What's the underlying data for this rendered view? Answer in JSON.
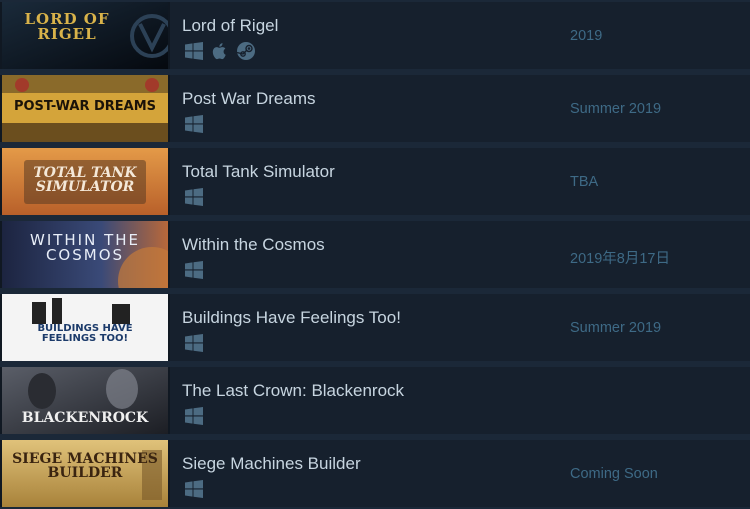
{
  "games": [
    {
      "title": "Lord of Rigel",
      "release": "2019",
      "platforms": [
        "windows-icon",
        "apple-icon",
        "steam-icon"
      ],
      "capsule_text": "LORD OF RIGEL",
      "capsule_colors": {
        "bg": "#0b1420",
        "text": "#d9b34a"
      }
    },
    {
      "title": "Post War Dreams",
      "release": "Summer 2019",
      "platforms": [
        "windows-icon"
      ],
      "capsule_text": "POST-WAR DREAMS",
      "capsule_colors": {
        "bg": "#d4a43a",
        "text": "#1a1208"
      }
    },
    {
      "title": "Total Tank Simulator",
      "release": "TBA",
      "platforms": [
        "windows-icon"
      ],
      "capsule_text": "TOTAL TANK SIMULATOR",
      "capsule_colors": {
        "bg": "#d9843a",
        "text": "#f4e8d8"
      }
    },
    {
      "title": "Within the Cosmos",
      "release": "2019年8月17日",
      "platforms": [
        "windows-icon"
      ],
      "capsule_text": "WITHIN THE COSMOS",
      "capsule_colors": {
        "bg": "#2e3a5a",
        "text": "#e8eef8"
      }
    },
    {
      "title": "Buildings Have Feelings Too!",
      "release": "Summer 2019",
      "platforms": [
        "windows-icon"
      ],
      "capsule_text": "BUILDINGS HAVE FEELINGS TOO!",
      "capsule_colors": {
        "bg": "#f4f4f4",
        "text": "#1b3a6a"
      }
    },
    {
      "title": "The Last Crown: Blackenrock",
      "release": "",
      "platforms": [
        "windows-icon"
      ],
      "capsule_text": "BLACKENROCK",
      "capsule_colors": {
        "bg": "#3a3e48",
        "text": "#f0f0f0"
      }
    },
    {
      "title": "Siege Machines Builder",
      "release": "Coming Soon",
      "platforms": [
        "windows-icon"
      ],
      "capsule_text": "SIEGE MACHINES BUILDER",
      "capsule_colors": {
        "bg": "#c9a55a",
        "text": "#3a2410"
      }
    }
  ],
  "colors": {
    "page_bg": "#1b2838",
    "row_bg": "#16202d",
    "title": "#c7d5e0",
    "release": "#3e6a86",
    "platform_icon": "#4c6b82"
  }
}
